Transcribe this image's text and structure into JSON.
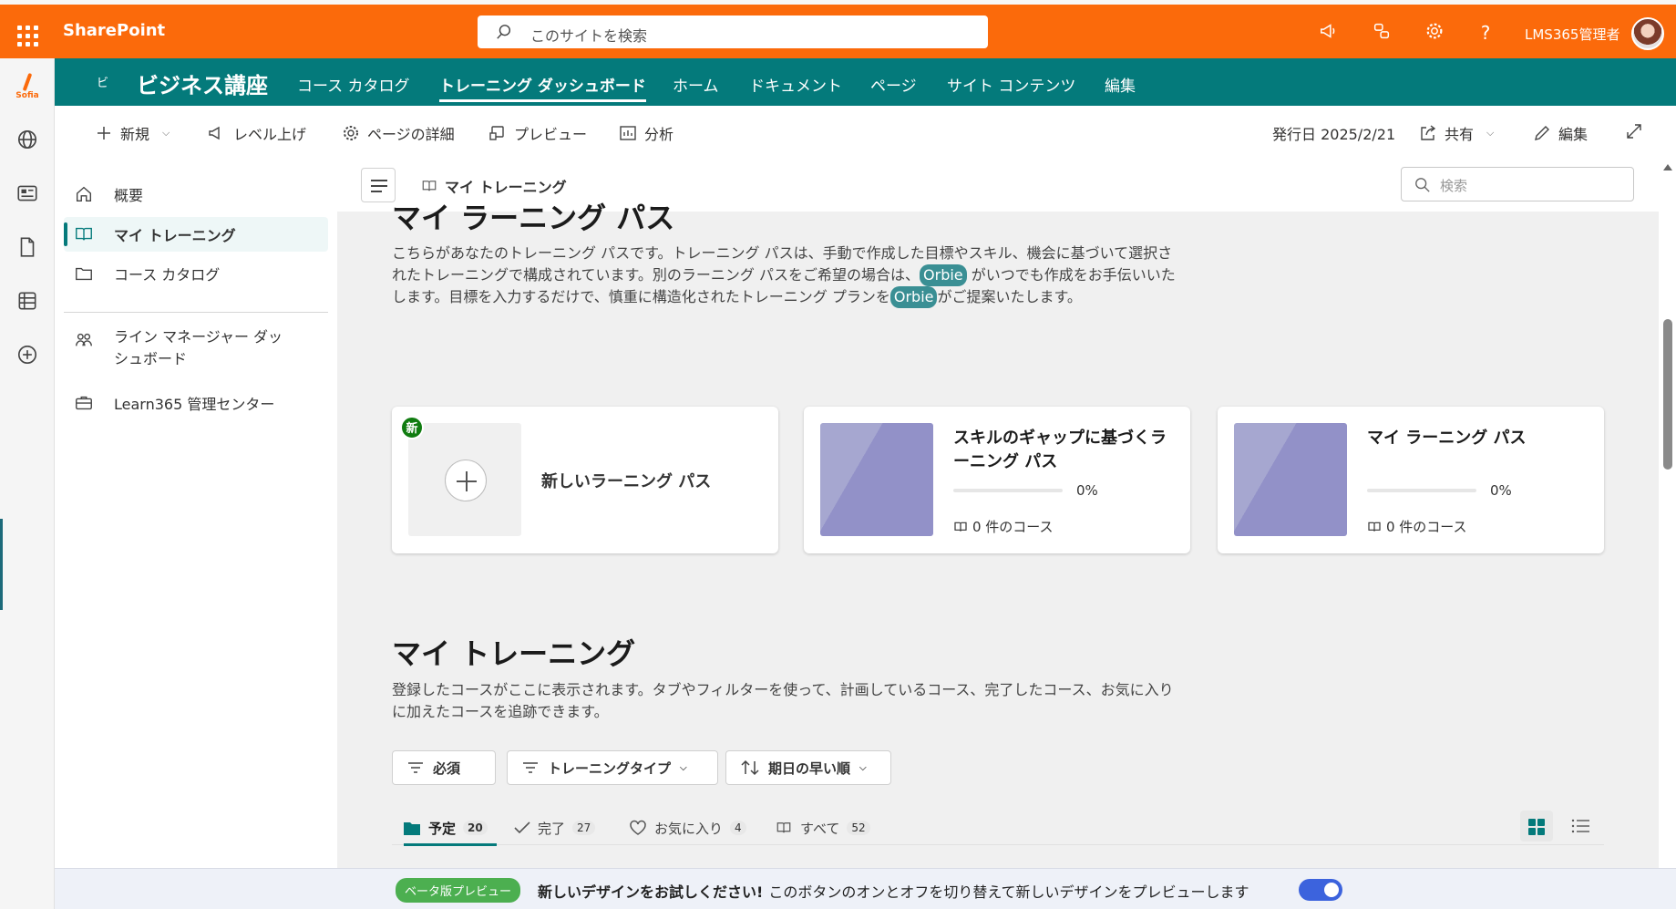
{
  "suite": {
    "app_name": "SharePoint",
    "search_placeholder": "このサイトを検索",
    "user_name": "LMS365管理者",
    "brand_color": "#fb6a0b"
  },
  "rail": {
    "logo_label": "Sofia",
    "icons": [
      "globe-icon",
      "news-icon",
      "document-icon",
      "list-icon",
      "add-circle-icon"
    ]
  },
  "site": {
    "badge": "ビ",
    "name": "ビジネス講座",
    "accent_color": "#047a7b",
    "nav": [
      "コース カタログ",
      "トレーニング ダッシュボード",
      "ホーム",
      "ドキュメント",
      "ページ",
      "サイト コンテンツ",
      "編集"
    ],
    "active_nav": "トレーニング ダッシュボード"
  },
  "commands": {
    "new": "新規",
    "level_up": "レベル上げ",
    "page_details": "ページの詳細",
    "preview": "プレビュー",
    "analytics": "分析",
    "published": "発行日 2025/2/21",
    "share": "共有",
    "edit": "編集"
  },
  "leftnav": {
    "items": [
      {
        "label": "概要",
        "icon": "home-icon"
      },
      {
        "label": "マイ トレーニング",
        "icon": "book-icon",
        "active": true
      },
      {
        "label": "コース カタログ",
        "icon": "folder-icon"
      }
    ],
    "items2": [
      {
        "label": "ライン マネージャー ダッシュボード",
        "icon": "people-icon"
      },
      {
        "label": "Learn365 管理センター",
        "icon": "briefcase-icon"
      }
    ]
  },
  "main": {
    "breadcrumb": "マイ トレーニング",
    "search_placeholder": "検索",
    "learning_paths": {
      "title": "マイ ラーニング パス",
      "desc_1": "こちらがあなたのトレーニング パスです。トレーニング パスは、手動で作成した目標やスキル、機会に基づいて選択されたトレーニングで構成されています。別のラーニング パスをご希望の場合は、",
      "orbie": "Orbie",
      "desc_2": " がいつでも作成をお手伝いいたします。目標を入力するだけで、慎重に構造化されたトレーニング プランを",
      "desc_3": "がご提案いたします。",
      "new_badge": "新",
      "new_card_label": "新しいラーニング パス",
      "cards": [
        {
          "title": "スキルのギャップに基づくラーニング パス",
          "progress": "0%",
          "courses": "0 件のコース"
        },
        {
          "title": "マイ ラーニング パス",
          "progress": "0%",
          "courses": "0 件のコース"
        }
      ]
    },
    "my_training": {
      "title": "マイ トレーニング",
      "desc": "登録したコースがここに表示されます。タブやフィルターを使って、計画しているコース、完了したコース、お気に入りに加えたコースを追跡できます。",
      "filters": [
        "必須",
        "トレーニングタイプ",
        "期日の早い順"
      ],
      "tabs": [
        {
          "label": "予定",
          "count": "20"
        },
        {
          "label": "完了",
          "count": "27"
        },
        {
          "label": "お気に入り",
          "count": "4"
        },
        {
          "label": "すべて",
          "count": "52"
        }
      ]
    }
  },
  "banner": {
    "badge": "ベータ版プレビュー",
    "headline": "新しいデザインをお試しください!",
    "text": "このボタンのオンとオフを切り替えて新しいデザインをプレビューします",
    "toggle_on": true
  }
}
